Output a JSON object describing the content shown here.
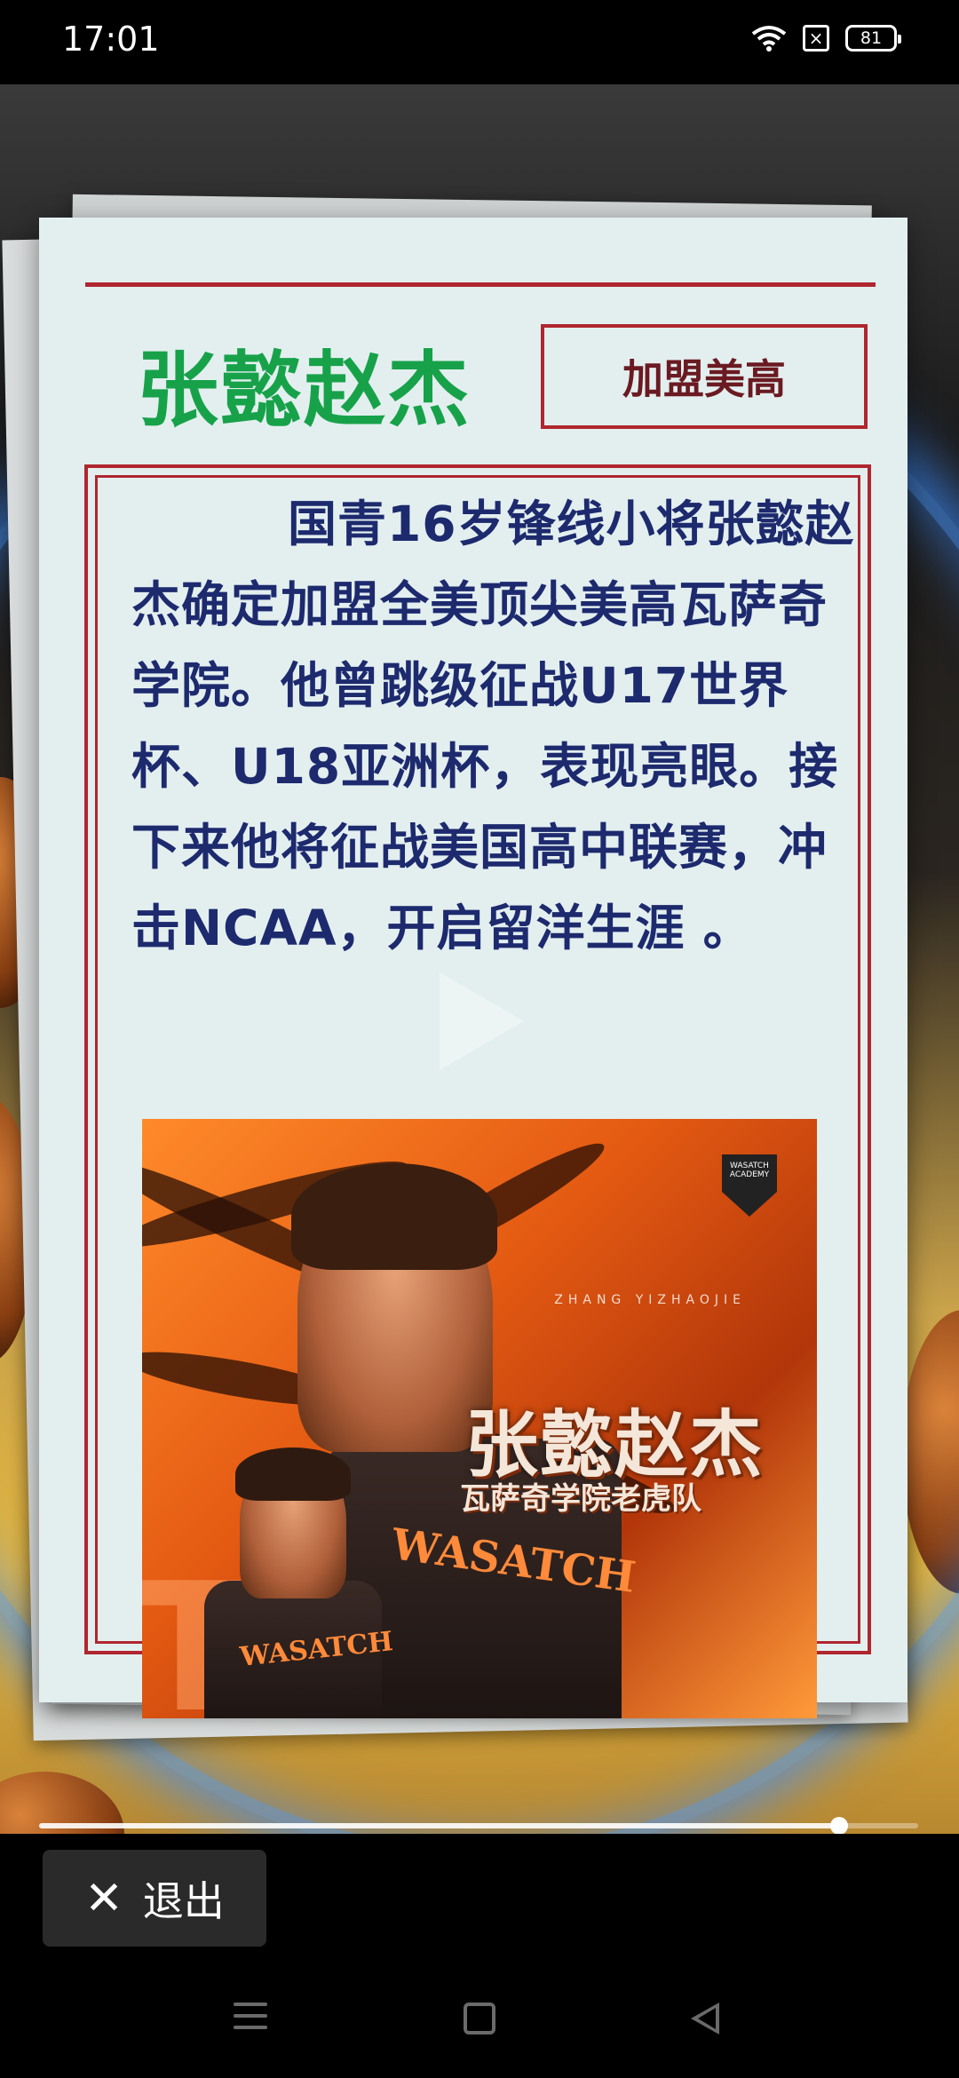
{
  "status_bar": {
    "time": "17:01",
    "battery": "81",
    "icons": [
      "wifi-icon",
      "no-sim-icon",
      "battery-icon"
    ]
  },
  "card": {
    "name": "张懿赵杰",
    "tag": "加盟美高",
    "body": "国青16岁锋线小将张懿赵杰确定加盟全美顶尖美高瓦萨奇学院。他曾跳级征战U17世界杯、U18亚洲杯，表现亮眼。接下来他将征战美国高中联赛，冲击NCAA，开启留洋生涯 。"
  },
  "poster": {
    "title": "张懿赵杰",
    "subtitle": "瓦萨奇学院老虎队",
    "small_text": "ZHANG YIZHAOJIE",
    "badge": "WASATCH ACADEMY",
    "jersey_text": "WASATCH",
    "big_letters": "TE"
  },
  "player": {
    "progress": 0.91
  },
  "exit_button": {
    "label": "退出",
    "icon": "close-icon"
  },
  "nav": {
    "items": [
      "menu-icon",
      "home-icon",
      "back-icon"
    ]
  },
  "colors": {
    "accent_red": "#b0262f",
    "name_green": "#17a24a",
    "body_blue": "#1d2a6e",
    "card_bg": "#e3efef"
  }
}
